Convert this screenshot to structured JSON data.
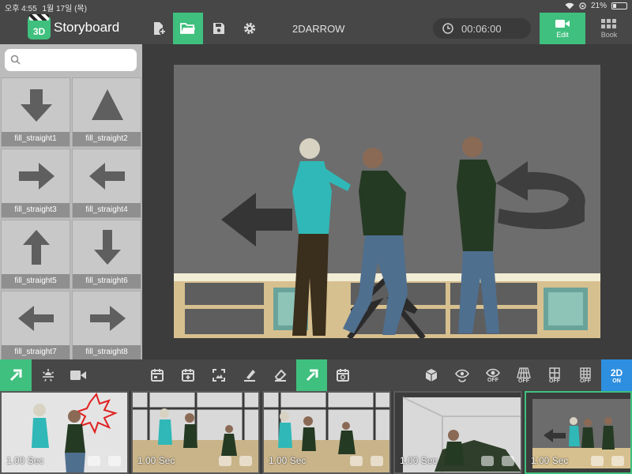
{
  "status_bar": {
    "time": "오후 4:55",
    "date": "1월 17일 (목)",
    "battery": "21%"
  },
  "toolbar": {
    "logo_text": "3D",
    "app_title": "Storyboard",
    "project_name": "2DARROW",
    "timer": "00:06:00",
    "edit_label": "Edit",
    "book_label": "Book",
    "accent": "#3fc07e"
  },
  "sidebar": {
    "search_placeholder": "",
    "items": [
      {
        "label": "fill_straight1",
        "icon": "arrow-down"
      },
      {
        "label": "fill_straight2",
        "icon": "triangle-up"
      },
      {
        "label": "fill_straight3",
        "icon": "arrow-right"
      },
      {
        "label": "fill_straight4",
        "icon": "arrow-left"
      },
      {
        "label": "fill_straight5",
        "icon": "arrow-up"
      },
      {
        "label": "fill_straight6",
        "icon": "arrow-down"
      },
      {
        "label": "fill_straight7",
        "icon": "arrow-left"
      },
      {
        "label": "fill_straight8",
        "icon": "arrow-right"
      }
    ]
  },
  "bottom_toolbar": {
    "tools_left": [
      "arrow-tool-icon",
      "light-icon",
      "camera-icon"
    ],
    "tools_mid": [
      "calendar-icon",
      "calendar-add-icon",
      "image-frame-icon",
      "highlighter-icon",
      "eraser-icon",
      "arrow-tool-icon",
      "calendar-refresh-icon"
    ],
    "toggles": [
      {
        "icon": "cube-icon",
        "label": ""
      },
      {
        "icon": "eye-cycle-icon",
        "label": ""
      },
      {
        "icon": "eye-icon",
        "label": "OFF"
      },
      {
        "icon": "floor-grid-icon",
        "label": "OFF"
      },
      {
        "icon": "frame-grid-icon",
        "label": "OFF"
      },
      {
        "icon": "grid-icon",
        "label": "OFF"
      }
    ],
    "mode_label": "2D",
    "mode_state": "ON"
  },
  "filmstrip": [
    {
      "duration": "1.00 Sec"
    },
    {
      "duration": "1.00 Sec"
    },
    {
      "duration": "1.00 Sec"
    },
    {
      "duration": "1.00 Sec"
    },
    {
      "duration": "1.00 Sec"
    }
  ]
}
